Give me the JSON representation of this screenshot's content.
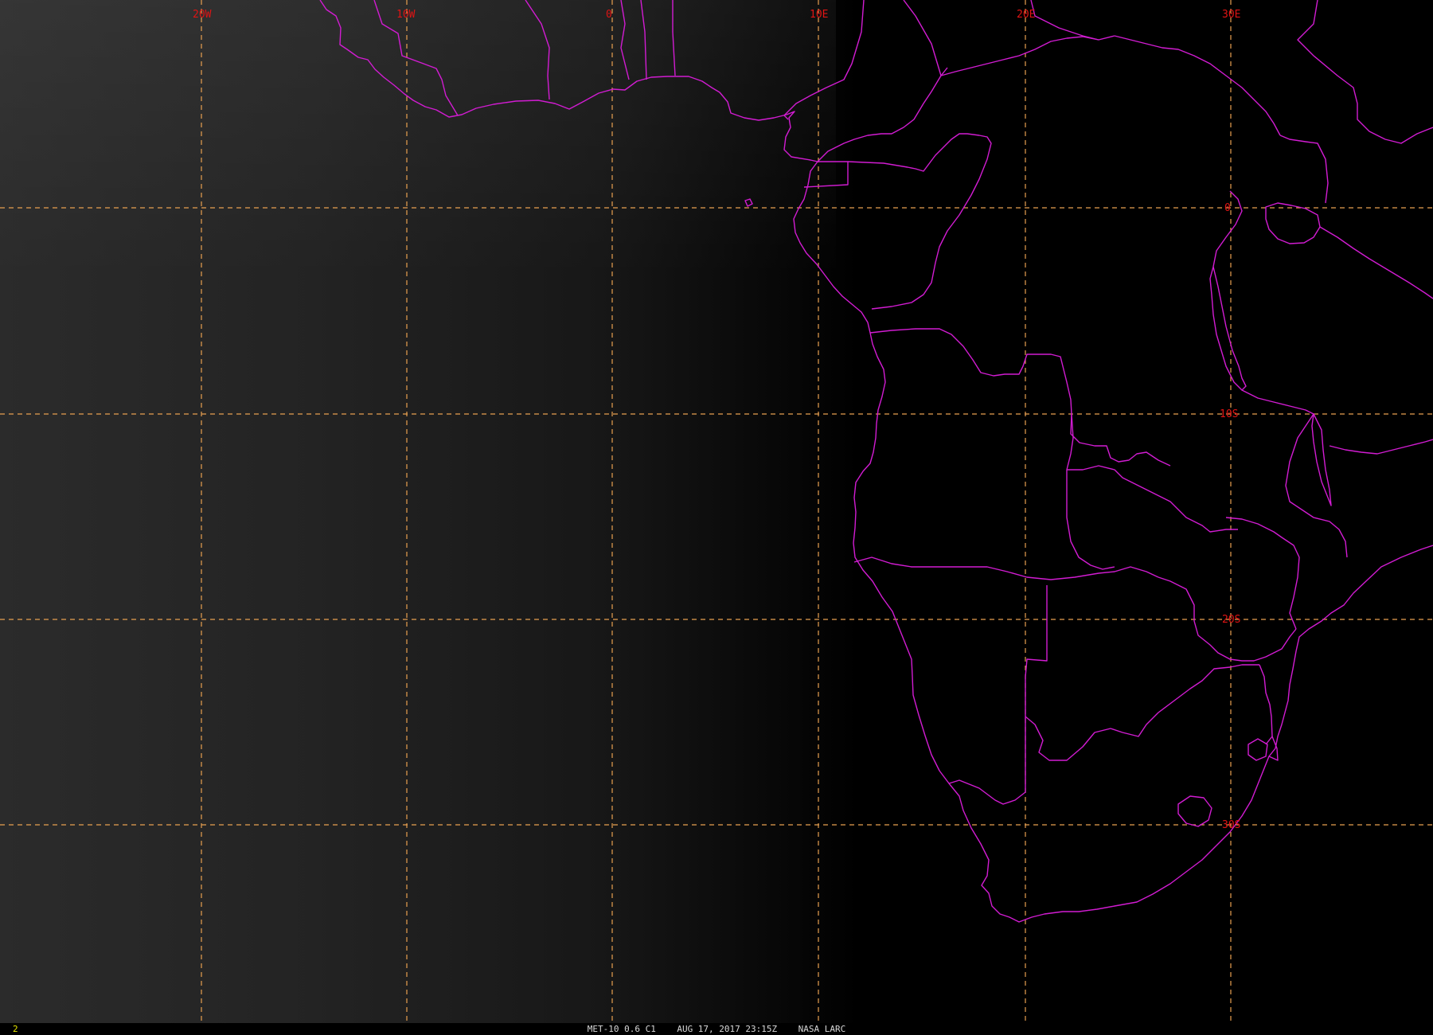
{
  "map": {
    "longitude_labels": [
      "20W",
      "10W",
      "0",
      "10E",
      "20E",
      "30E"
    ],
    "latitude_labels": [
      "0",
      "10S",
      "20S",
      "30S"
    ],
    "colors": {
      "borders": "#d21cd2",
      "graticule": "#e8a050",
      "grid_labels": "#e01414",
      "background": "#000000"
    }
  },
  "status": {
    "frame": "2",
    "caption": "MET-10 0.6 C1    AUG 17, 2017 23:15Z    NASA LARC"
  }
}
